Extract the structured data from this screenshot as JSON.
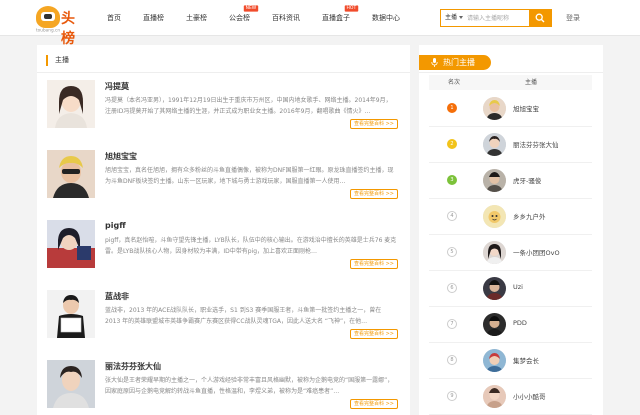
{
  "brand": {
    "name": "头榜",
    "sub": "toubang.cn"
  },
  "nav": [
    {
      "label": "首页",
      "badge": ""
    },
    {
      "label": "直播榜",
      "badge": ""
    },
    {
      "label": "土豪榜",
      "badge": ""
    },
    {
      "label": "公会榜",
      "badge": "NEW"
    },
    {
      "label": "百科资讯",
      "badge": ""
    },
    {
      "label": "直播盒子",
      "badge": "HOT"
    },
    {
      "label": "数据中心",
      "badge": ""
    }
  ],
  "search": {
    "category": "主播",
    "placeholder": "请输入主播昵称"
  },
  "login_label": "登录",
  "main": {
    "section_title": "主播",
    "more_label": "查看完整百科 >>",
    "entries": [
      {
        "name": "冯提莫",
        "desc": "冯提莫（本名冯亚男），1991年12月19日出生于重庆市万州区，中国内地女歌手、网络主播。2014年9月，注册ID冯提莫开始了其网络主播的生涯，并正式成为职业女主播。2016年9月，翻唱歌曲《情火》…"
      },
      {
        "name": "旭旭宝宝",
        "desc": "旭旭宝宝，真名任旭旭，拥有众多粉丝的斗鱼直播偶像，被称为DNF国服第一红眼。原龙珠直播签约主播，现为斗鱼DNF板块签约主播。山东一区玩家，地下城与勇士游戏玩家，国服直播第一人使用…"
      },
      {
        "name": "pigff",
        "desc": "pigff，真名赵怡暄，斗鱼守望先锋主播，LYB队长，队伍中的核心输出。在游戏治中擅长的英雄是士兵76 麦克雷。是LYB战队核心人物，因身材较为丰满，ID中带有pig，加上喜欢正面刚枪…"
      },
      {
        "name": "蓝战非",
        "desc": "蓝战非，2013 年的ACE战队队长，职业选手，S1 到S3 赛季国服王者，斗鱼第一批签约主播之一，曾在 2013 年的英雄联盟城市英雄争霸赛广东赛区获得CC战队灵魂TGA，因此人送大名 “飞神”，在他…"
      },
      {
        "name": "丽法芬芬张大仙",
        "desc": "张大仙是王者荣耀早期的主播之一，个人游戏经验非常丰富且风格幽默，被称为企鹅电竞的“国服第一露娜”，因家庭原因与企鹅电竞解约转战斗鱼直播，性格温和，李煜义弟，被称为是“难癌患者”…"
      }
    ]
  },
  "side": {
    "tab_label": "热门主播",
    "col_rank": "名次",
    "col_name": "主播",
    "rows": [
      {
        "rank": "1",
        "name": "旭旭宝宝"
      },
      {
        "rank": "2",
        "name": "丽法芬芬张大仙"
      },
      {
        "rank": "3",
        "name": "虎牙-骚俊"
      },
      {
        "rank": "4",
        "name": "乡乡九户外"
      },
      {
        "rank": "5",
        "name": "一条小团团OvO"
      },
      {
        "rank": "6",
        "name": "Uzi"
      },
      {
        "rank": "7",
        "name": "PDD"
      },
      {
        "rank": "8",
        "name": "集梦会长"
      },
      {
        "rank": "9",
        "name": "小小小酷哥"
      }
    ]
  },
  "colors": {
    "accent": "#f39800",
    "rank1": "#f56f0a",
    "rank2": "#f2c31b",
    "rank3": "#7cc23a"
  }
}
